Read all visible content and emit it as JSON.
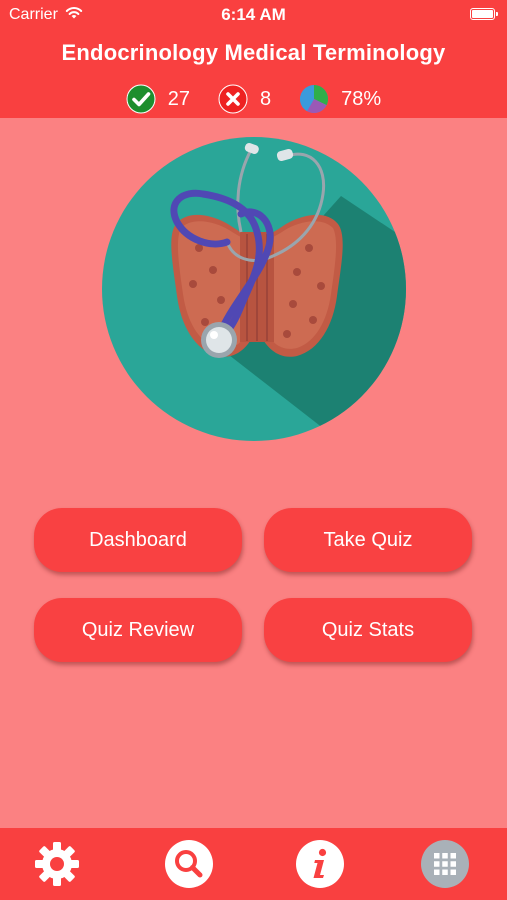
{
  "status_bar": {
    "carrier": "Carrier",
    "time": "6:14 AM"
  },
  "header": {
    "title": "Endocrinology Medical Terminology",
    "stats": {
      "correct": "27",
      "incorrect": "8",
      "score": "78%"
    }
  },
  "menu": {
    "dashboard": "Dashboard",
    "take_quiz": "Take Quiz",
    "quiz_review": "Quiz Review",
    "quiz_stats": "Quiz Stats"
  },
  "tabbar": {
    "items": [
      "gear-icon",
      "search-icon",
      "info-icon",
      "grid-icon"
    ]
  },
  "colors": {
    "header_red": "#f94040",
    "background": "#fb8182",
    "button_red": "#f94142",
    "teal": "#2aa698",
    "correct_green": "#1e8e2e",
    "incorrect_red": "#ee2222"
  },
  "illustration": {
    "subject": "thyroid gland with stethoscope"
  }
}
